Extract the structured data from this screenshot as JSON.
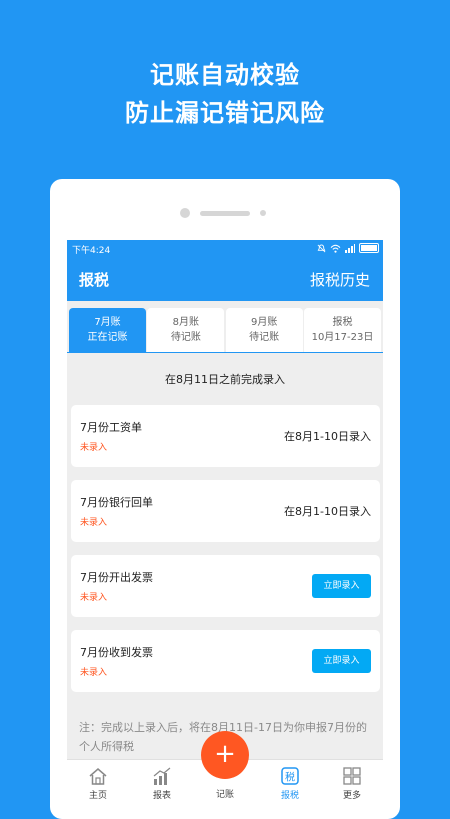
{
  "headline": {
    "line1": "记账自动校验",
    "line2": "防止漏记错记风险"
  },
  "status_bar": {
    "time": "下午4:24"
  },
  "app_bar": {
    "title": "报税",
    "history": "报税历史"
  },
  "tabs": [
    {
      "line1": "7月账",
      "line2": "正在记账"
    },
    {
      "line1": "8月账",
      "line2": "待记账"
    },
    {
      "line1": "9月账",
      "line2": "待记账"
    },
    {
      "line1": "报税",
      "line2": "10月17-23日"
    }
  ],
  "deadline": "在8月11日之前完成录入",
  "cards": [
    {
      "name": "7月份工资单",
      "state": "未录入",
      "action": "在8月1-10日录入"
    },
    {
      "name": "7月份银行回单",
      "state": "未录入",
      "action": "在8月1-10日录入"
    },
    {
      "name": "7月份开出发票",
      "state": "未录入",
      "action": "立即录入"
    },
    {
      "name": "7月份收到发票",
      "state": "未录入",
      "action": "立即录入"
    }
  ],
  "note": "注：完成以上录入后，将在8月11日-17日为你申报7月份的个人所得税",
  "bottom_nav": {
    "home": "主页",
    "report": "报表",
    "record": "记账",
    "tax": "报税",
    "more": "更多",
    "fab_symbol": "+"
  },
  "colors": {
    "primary": "#2196f3",
    "accent": "#ff5722",
    "button": "#03a9f4"
  }
}
